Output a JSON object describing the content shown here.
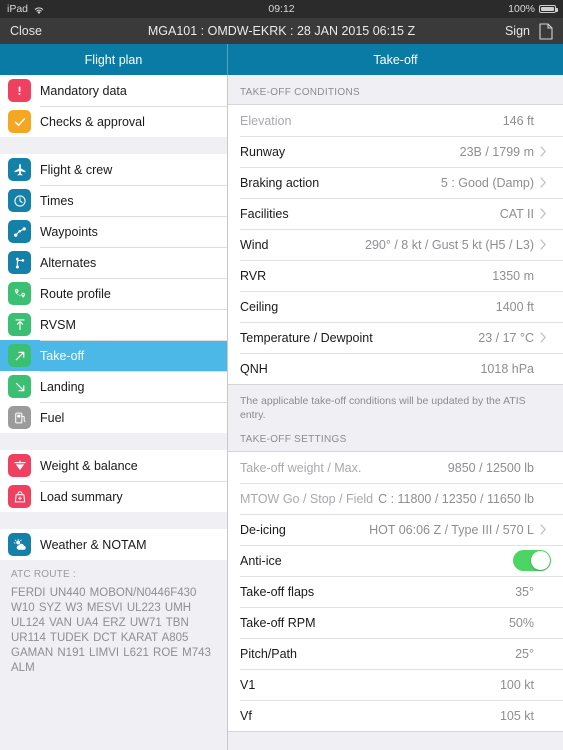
{
  "status_bar": {
    "device": "iPad",
    "wifi_icon": "wifi-icon",
    "time": "09:12",
    "battery_percent": "100%",
    "battery_icon": "battery-icon"
  },
  "title_bar": {
    "close_label": "Close",
    "title": "MGA101 : OMDW-EKRK : 28 JAN 2015 06:15 Z",
    "sign_label": "Sign",
    "doc_icon": "document-icon"
  },
  "tabs": [
    {
      "label": "Flight plan",
      "active": false
    },
    {
      "label": "Take-off",
      "active": true
    }
  ],
  "sidebar": {
    "groups": [
      {
        "items": [
          {
            "label": "Mandatory data",
            "icon": "exclamation-icon",
            "color": "#ef4060",
            "selected": false
          },
          {
            "label": "Checks & approval",
            "icon": "check-icon",
            "color": "#f5a623",
            "selected": false
          }
        ]
      },
      {
        "items": [
          {
            "label": "Flight & crew",
            "icon": "airplane-icon",
            "color": "#1581a8",
            "selected": false
          },
          {
            "label": "Times",
            "icon": "clock-icon",
            "color": "#1581a8",
            "selected": false
          },
          {
            "label": "Waypoints",
            "icon": "waypoints-icon",
            "color": "#1581a8",
            "selected": false
          },
          {
            "label": "Alternates",
            "icon": "branch-icon",
            "color": "#1581a8",
            "selected": false
          },
          {
            "label": "Route profile",
            "icon": "map-pins-icon",
            "color": "#3bbf72",
            "selected": false
          },
          {
            "label": "RVSM",
            "icon": "up-arrow-icon",
            "color": "#3bbf72",
            "selected": false
          },
          {
            "label": "Take-off",
            "icon": "takeoff-arrow-icon",
            "color": "#3bbf72",
            "selected": true
          },
          {
            "label": "Landing",
            "icon": "landing-arrow-icon",
            "color": "#3bbf72",
            "selected": false
          },
          {
            "label": "Fuel",
            "icon": "fuel-pump-icon",
            "color": "#9b9b9b",
            "selected": false
          }
        ]
      },
      {
        "items": [
          {
            "label": "Weight & balance",
            "icon": "scale-icon",
            "color": "#ef4060",
            "selected": false
          },
          {
            "label": "Load summary",
            "icon": "bag-icon",
            "color": "#ef4060",
            "selected": false
          }
        ]
      },
      {
        "items": [
          {
            "label": "Weather & NOTAM",
            "icon": "sun-cloud-icon",
            "color": "#1581a8",
            "selected": false
          }
        ]
      }
    ],
    "atc_route": {
      "heading": "ATC ROUTE :",
      "body": "FERDI UN440 MOBON/N0446F430 W10 SYZ W3 MESVI UL223 UMH UL124 VAN UA4 ERZ UW71 TBN UR114 TUDEK DCT KARAT A805 GAMAN N191 LIMVI L621 ROE M743 ALM"
    }
  },
  "main": {
    "conditions_header": "TAKE-OFF CONDITIONS",
    "conditions": [
      {
        "label": "Elevation",
        "value": "146 ft",
        "dim": true,
        "chevron": false
      },
      {
        "label": "Runway",
        "value": "23B / 1799 m",
        "dim": false,
        "chevron": true
      },
      {
        "label": "Braking action",
        "value": "5 : Good (Damp)",
        "dim": false,
        "chevron": true
      },
      {
        "label": "Facilities",
        "value": "CAT II",
        "dim": false,
        "chevron": true
      },
      {
        "label": "Wind",
        "value": "290° / 8 kt / Gust 5 kt (H5 / L3)",
        "dim": false,
        "chevron": true
      },
      {
        "label": "RVR",
        "value": "1350 m",
        "dim": false,
        "chevron": false
      },
      {
        "label": "Ceiling",
        "value": "1400 ft",
        "dim": false,
        "chevron": false
      },
      {
        "label": "Temperature / Dewpoint",
        "value": "23 / 17 °C",
        "dim": false,
        "chevron": true
      },
      {
        "label": "QNH",
        "value": "1018 hPa",
        "dim": false,
        "chevron": false
      }
    ],
    "note": "The applicable take-off conditions will be updated by the ATIS entry.",
    "settings_header": "TAKE-OFF SETTINGS",
    "settings": [
      {
        "label": "Take-off weight / Max.",
        "value": "9850 / 12500 lb",
        "dim": true,
        "chevron": false,
        "toggle": false
      },
      {
        "label": "MTOW Go / Stop / Field",
        "value": "C : 11800 / 12350 / 11650 lb",
        "dim": true,
        "chevron": false,
        "toggle": false
      },
      {
        "label": "De-icing",
        "value": "HOT 06:06 Z / Type III / 570 L",
        "dim": false,
        "chevron": true,
        "toggle": false
      },
      {
        "label": "Anti-ice",
        "value": "",
        "dim": false,
        "chevron": false,
        "toggle": true,
        "toggle_on": true
      },
      {
        "label": "Take-off flaps",
        "value": "35°",
        "dim": false,
        "chevron": false,
        "toggle": false
      },
      {
        "label": "Take-off RPM",
        "value": "50%",
        "dim": false,
        "chevron": false,
        "toggle": false
      },
      {
        "label": "Pitch/Path",
        "value": "25°",
        "dim": false,
        "chevron": false,
        "toggle": false
      },
      {
        "label": "V1",
        "value": "100 kt",
        "dim": false,
        "chevron": false,
        "toggle": false
      },
      {
        "label": "Vf",
        "value": "105 kt",
        "dim": false,
        "chevron": false,
        "toggle": false
      }
    ]
  },
  "colors": {
    "tab_bar": "#0a7ba5",
    "selected_row": "#4cb8e8",
    "toggle_on": "#4cd464"
  }
}
